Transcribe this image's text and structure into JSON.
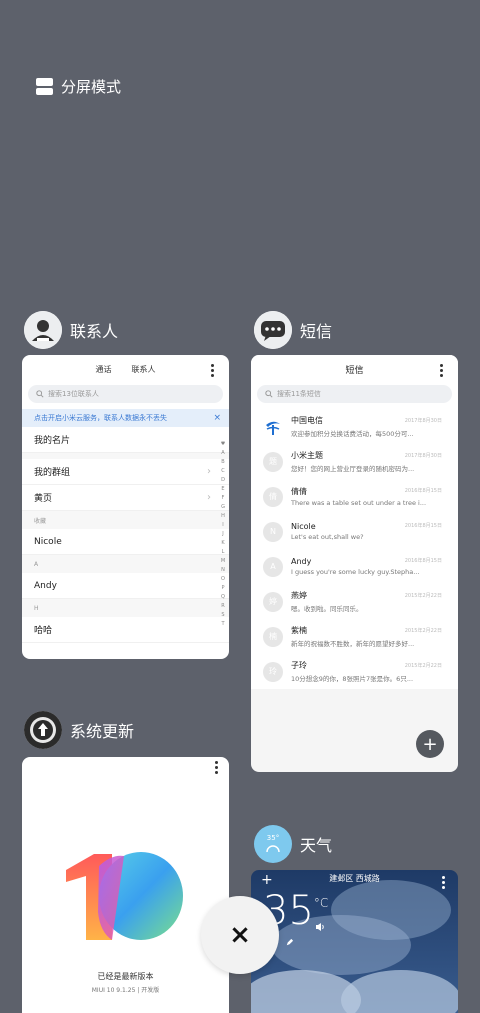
{
  "split_mode": {
    "label": "分屏模式"
  },
  "contacts": {
    "app_name": "联系人",
    "tabs": [
      "通话",
      "联系人"
    ],
    "search_placeholder": "搜索13位联系人",
    "banner": "点击开启小米云服务，联系人数据永不丢失",
    "banner_close": "×",
    "rows": [
      {
        "type": "row",
        "text": "我的名片",
        "chevron": false
      },
      {
        "type": "gap"
      },
      {
        "type": "row",
        "text": "我的群组",
        "chevron": true
      },
      {
        "type": "row",
        "text": "黄页",
        "chevron": true
      },
      {
        "type": "section",
        "text": "收藏"
      },
      {
        "type": "row",
        "text": "Nicole",
        "chevron": false
      },
      {
        "type": "section",
        "text": "A"
      },
      {
        "type": "row",
        "text": "Andy",
        "chevron": false
      },
      {
        "type": "section",
        "text": "H"
      },
      {
        "type": "row",
        "text": "哈哈",
        "chevron": false
      }
    ],
    "alphabet": [
      "♥",
      "A",
      "B",
      "C",
      "D",
      "E",
      "F",
      "G",
      "H",
      "I",
      "J",
      "K",
      "L",
      "M",
      "N",
      "O",
      "P",
      "Q",
      "R",
      "S",
      "T"
    ]
  },
  "sms": {
    "app_name": "短信",
    "title": "短信",
    "search_placeholder": "搜索11条短信",
    "messages": [
      {
        "avatar": "telecom-logo",
        "name": "中国电信",
        "preview": "欢迎参加积分兑换话费活动，每500分可...",
        "date": "2017年8月30日"
      },
      {
        "avatar": "题",
        "name": "小米主题",
        "preview": "您好！您的网上营业厅登录的随机密码为...",
        "date": "2017年8月30日"
      },
      {
        "avatar": "倩",
        "name": "倩倩",
        "preview": "There was a table set out under a tree i...",
        "date": "2016年8月15日"
      },
      {
        "avatar": "N",
        "name": "Nicole",
        "preview": "Let's eat out,shall we?",
        "date": "2016年8月15日"
      },
      {
        "avatar": "A",
        "name": "Andy",
        "preview": "I guess you're some lucky guy.Stepha...",
        "date": "2016年8月15日"
      },
      {
        "avatar": "婷",
        "name": "燕婷",
        "preview": "嗯。收到啦。同乐同乐。",
        "date": "2015年2月22日"
      },
      {
        "avatar": "楠",
        "name": "紫楠",
        "preview": "新年的祝福数不胜数，新年的愿望好多好...",
        "date": "2015年2月22日"
      },
      {
        "avatar": "玲",
        "name": "子玲",
        "preview": "10分想念9的你，8张照片7张是你。6只...",
        "date": "2015年2月22日"
      }
    ],
    "fab": "+"
  },
  "updater": {
    "app_name": "系统更新",
    "status": "已经是最新版本",
    "version": "MIUI 10 9.1.25 | 开发版"
  },
  "weather": {
    "app_name": "天气",
    "icon_temp": "35°",
    "location": "建邺区 西城路",
    "temperature": "35",
    "unit": "°C",
    "add": "+"
  },
  "close_button": "×"
}
